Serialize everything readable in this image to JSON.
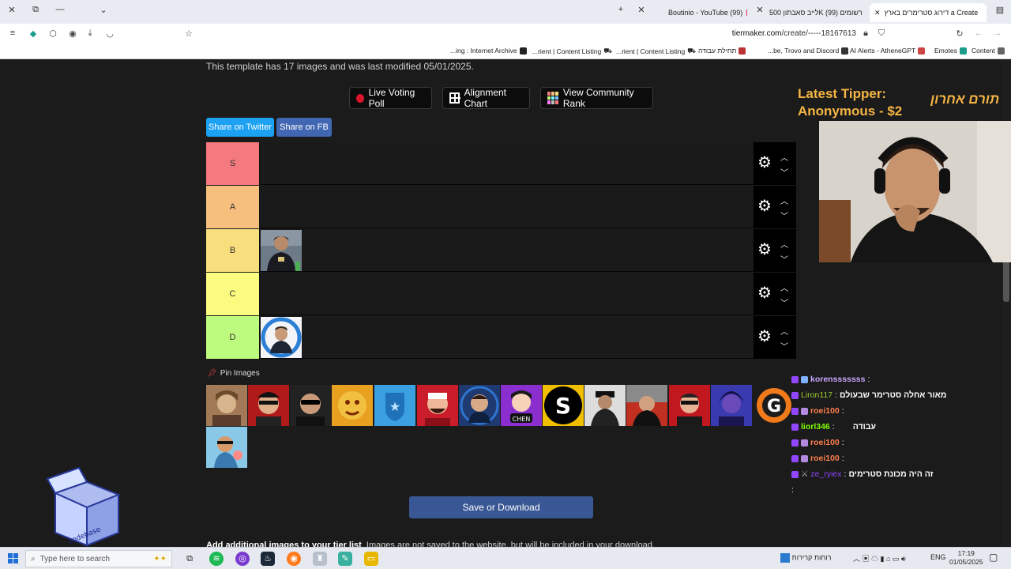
{
  "browser": {
    "tabs": [
      {
        "label": "דירוג סטרימרים בארץ a Create",
        "active": true
      },
      {
        "label": "לייב סאבתון 500K רשומים (99)",
        "active": false
      },
      {
        "label": "Boutinio - YouTube (99)",
        "active": false
      }
    ],
    "url_domain": "tiermaker.com",
    "url_path": "/create/-----18167613",
    "bookmarks": [
      "Content",
      "Emotes",
      "AI Alerts - AtheneGPT",
      "...be, Trovo and Discord",
      "תחילת עבודה",
      "...rient | Content Listing",
      "...rient | Content Listing",
      "...ing : Internet Archive"
    ]
  },
  "page": {
    "template_info": "This template has 17 images and was last modified 05/01/2025.",
    "buttons": {
      "live_voting": "Live Voting Poll",
      "alignment": "Alignment Chart",
      "community_rank": "View Community Rank",
      "share_twitter": "Share on Twitter",
      "share_fb": "Share on FB"
    },
    "tiers": [
      {
        "label": "S",
        "color": "#f47a7f"
      },
      {
        "label": "A",
        "color": "#f7bf7e"
      },
      {
        "label": "B",
        "color": "#f9de7e"
      },
      {
        "label": "C",
        "color": "#fbfb7f"
      },
      {
        "label": "D",
        "color": "#bdfb7e"
      }
    ],
    "pin_images": "Pin Images",
    "save_button": "Save or Download",
    "additional_bold": "Add additional images to your tier list",
    "additional_rest": ". Images are not saved to the website, but will be included in your download."
  },
  "overlay": {
    "tipper_line1": "Latest Tipper:",
    "tipper_line2": "Anonymous - $2",
    "tipper_hebrew": "תורם אחרון",
    "chat": [
      {
        "name": "korensssssss",
        "msg": "",
        "name_color": "#c9a7ff"
      },
      {
        "name": "Liron117",
        "msg": "מאור אחלה סטרימר שבעולם",
        "name_color": "#9acd32"
      },
      {
        "name": "roei100",
        "msg": "",
        "name_color": "#ff7f50"
      },
      {
        "name": "liorl346",
        "msg": "עבודה",
        "name_color": "#7fff00"
      },
      {
        "name": "roei100",
        "msg": "",
        "name_color": "#ff7f50"
      },
      {
        "name": "roei100",
        "msg": "",
        "name_color": "#ff7f50"
      },
      {
        "name": "ze_ryiex",
        "msg": "זה היה מכונת סטרימים",
        "name_color": "#9146ff"
      }
    ],
    "codebase_label": "codebase"
  },
  "taskbar": {
    "search_placeholder": "Type here to search",
    "weather": "רוחות קרירות",
    "lang": "ENG",
    "time": "17:19",
    "date": "01/05/2025"
  }
}
